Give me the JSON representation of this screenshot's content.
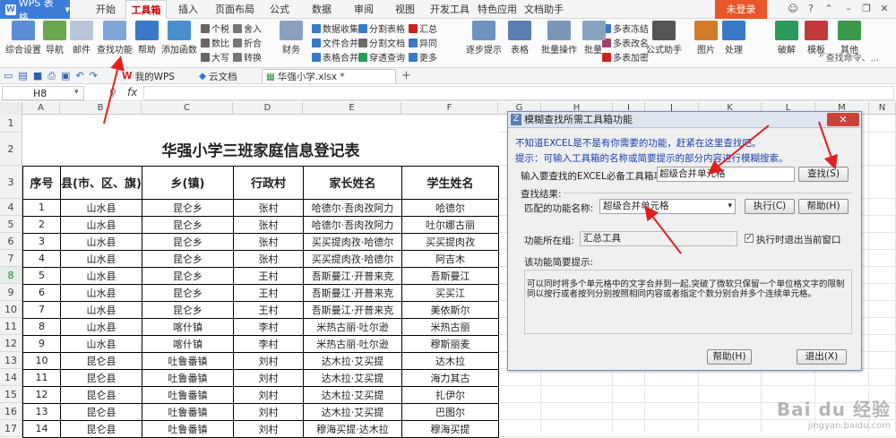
{
  "app": {
    "name": "WPS 表格",
    "badge": "W"
  },
  "menu_tabs": [
    "开始",
    "工具箱",
    "插入",
    "页面布局",
    "公式",
    "数据",
    "审阅",
    "视图",
    "开发工具",
    "特色应用",
    "文档助手"
  ],
  "active_menu": "工具箱",
  "login_label": "未登录",
  "ribbon": {
    "big_buttons": [
      "综合设置",
      "导航",
      "邮件",
      "查找功能",
      "帮助",
      "添加函数"
    ],
    "small_col1": [
      "个税",
      "数比",
      "大写"
    ],
    "small_col2": [
      "舍入",
      "折合",
      "转换"
    ],
    "caiwu": "财务",
    "small_col3": [
      "数据收集",
      "文件合并",
      "表格合并"
    ],
    "small_col4": [
      "分割表格",
      "分割文档",
      "穿透查询"
    ],
    "small_col5": [
      "汇总",
      "异同",
      "更多"
    ],
    "zhubu": "逐步提示",
    "biaoge": "表格",
    "piliang": "批量操作",
    "piliang2": "批量",
    "small_col6": [
      "多表冻结",
      "多表改名",
      "多表加密"
    ],
    "formula_helper": "公式助手",
    "pic": "图片",
    "process": "处理",
    "crack": "破解",
    "template": "模板",
    "other": "其他",
    "search_placeholder": "查找命令、..."
  },
  "quick_tabs": [
    "我的WPS",
    "云文档",
    "华强小学.xlsx *"
  ],
  "name_box": "H8",
  "fx": "fx",
  "columns": [
    "A",
    "B",
    "C",
    "D",
    "E",
    "F",
    "G",
    "H",
    "I",
    "J",
    "K",
    "L",
    "M",
    "N"
  ],
  "rows": [
    "1",
    "2",
    "3",
    "4",
    "5",
    "6",
    "7",
    "8",
    "9",
    "10",
    "11",
    "12",
    "13",
    "14",
    "15",
    "16",
    "17"
  ],
  "sheet": {
    "title": "华强小学三班家庭信息登记表",
    "headers": [
      "序号",
      "县(市、区、旗)",
      "乡(镇)",
      "行政村",
      "家长姓名",
      "学生姓名"
    ],
    "data": [
      [
        "1",
        "山水县",
        "昆仑乡",
        "张村",
        "哈德尔·吾肉孜阿力",
        "哈德尔"
      ],
      [
        "2",
        "山水县",
        "昆仑乡",
        "张村",
        "哈德尔·吾肉孜阿力",
        "吐尔娜古丽"
      ],
      [
        "3",
        "山水县",
        "昆仑乡",
        "张村",
        "买买提肉孜·哈德尔",
        "买买提肉孜"
      ],
      [
        "4",
        "山水县",
        "昆仑乡",
        "张村",
        "买买提肉孜·哈德尔",
        "阿吉木"
      ],
      [
        "5",
        "山水县",
        "昆仑乡",
        "王村",
        "吾斯曼江·开普来克",
        "吾斯曼江"
      ],
      [
        "6",
        "山水县",
        "昆仑乡",
        "王村",
        "吾斯曼江·开普来克",
        "买买江"
      ],
      [
        "7",
        "山水县",
        "昆仑乡",
        "王村",
        "吾斯曼江·开普来克",
        "美依斯尔"
      ],
      [
        "8",
        "山水县",
        "喀什镇",
        "李村",
        "米热古丽·吐尔逊",
        "米热古丽"
      ],
      [
        "9",
        "山水县",
        "喀什镇",
        "李村",
        "米热古丽·吐尔逊",
        "穆斯丽麦"
      ],
      [
        "10",
        "昆仑县",
        "吐鲁番镇",
        "刘村",
        "达木拉·艾买提",
        "达木拉"
      ],
      [
        "11",
        "昆仑县",
        "吐鲁番镇",
        "刘村",
        "达木拉·艾买提",
        "海力其古"
      ],
      [
        "12",
        "昆仑县",
        "吐鲁番镇",
        "刘村",
        "达木拉·艾买提",
        "扎伊尔"
      ],
      [
        "13",
        "昆仑县",
        "吐鲁番镇",
        "刘村",
        "达木拉·艾买提",
        "巴图尔"
      ],
      [
        "14",
        "昆仑县",
        "吐鲁番镇",
        "刘村",
        "穆海买提·达木拉",
        "穆海买提"
      ]
    ]
  },
  "dialog": {
    "title": "模糊查找所需工具箱功能",
    "close": "✕",
    "desc": "不知道EXCEL是不是有你需要的功能，赶紧在这里查找吧。",
    "hint": "提示：可输入工具箱的名称或简要提示的部分内容进行模糊搜索。",
    "input_label": "输入要查找的EXCEL必备工具箱功能:",
    "input_value": "超级合并单元格",
    "find_btn": "查找(S)",
    "results_label": "查找结果:",
    "match_label": "匹配的功能名称:",
    "match_value": "超级合并单元格",
    "exec_btn": "执行(C)",
    "help_btn": "帮助(H)",
    "group_label": "功能所在组:",
    "group_value": "汇总工具",
    "exit_check": "执行时退出当前窗口",
    "brief_label": "该功能简要提示:",
    "brief_text": "可以同时将多个单元格中的文字合并到一起,突破了微软只保留一个单位格文字的限制同以按行或者按列分别按照相同内容或者指定个数分别合并多个连续单元格。",
    "bottom_help": "帮助(H)",
    "bottom_exit": "退出(X)"
  },
  "watermark": {
    "brand": "Bai du 经验",
    "url": "jingyan.baidu.com"
  },
  "colors": {
    "accent": "#3d7dd8",
    "login": "#e8562a",
    "arrow": "#e02020",
    "dialog_text_blue": "#1a3fb0"
  }
}
